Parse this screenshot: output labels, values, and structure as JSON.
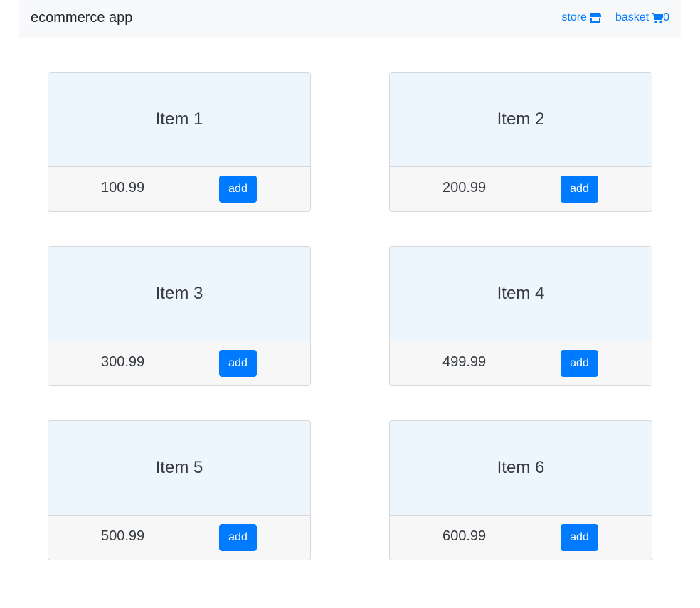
{
  "navbar": {
    "brand": "ecommerce app",
    "store_label": "store",
    "store_icon": "store-icon",
    "basket_label": "basket",
    "basket_icon": "cart-icon",
    "basket_count": "0"
  },
  "products": [
    {
      "name": "Item 1",
      "price": "100.99",
      "button": "add"
    },
    {
      "name": "Item 2",
      "price": "200.99",
      "button": "add"
    },
    {
      "name": "Item 3",
      "price": "300.99",
      "button": "add"
    },
    {
      "name": "Item 4",
      "price": "499.99",
      "button": "add"
    },
    {
      "name": "Item 5",
      "price": "500.99",
      "button": "add"
    },
    {
      "name": "Item 6",
      "price": "600.99",
      "button": "add"
    }
  ],
  "colors": {
    "accent": "#007bff",
    "navbar_bg": "#f8f9fa",
    "card_body_bg": "#eef6fd",
    "card_footer_bg": "#f7f7f7"
  }
}
